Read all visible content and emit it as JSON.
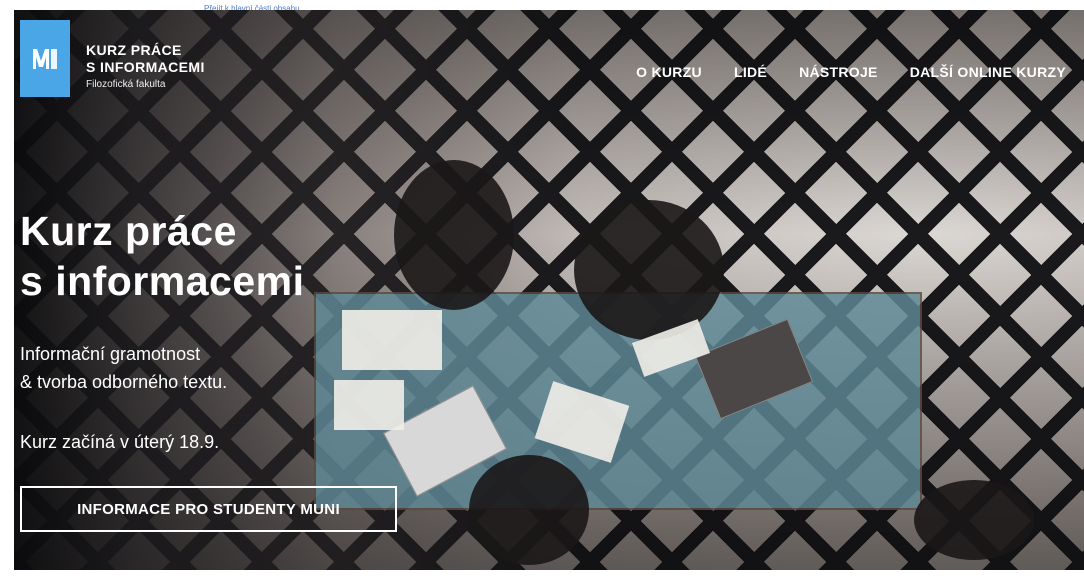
{
  "skip_link": "Přejít k hlavní části obsahu",
  "brand": {
    "line1": "KURZ PRÁCE",
    "line2": "S INFORMACEMI",
    "line3": "Filozofická fakulta",
    "logo_icon": "muni-logo-icon",
    "accent": "#4aa6e6"
  },
  "nav": {
    "items": [
      {
        "label": "O KURZU"
      },
      {
        "label": "LIDÉ"
      },
      {
        "label": "NÁSTROJE"
      },
      {
        "label": "DALŠÍ ONLINE KURZY"
      }
    ]
  },
  "hero": {
    "title_line1": "Kurz práce",
    "title_line2": "s informacemi",
    "subtitle_line1": "Informační gramotnost",
    "subtitle_line2": "& tvorba odborného textu.",
    "start": "Kurz začíná v úterý 18.9.",
    "cta": "INFORMACE PRO STUDENTY MUNI"
  }
}
